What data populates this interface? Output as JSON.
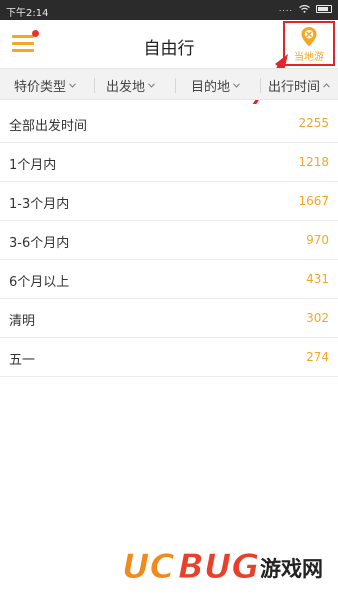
{
  "status_bar": {
    "time": "下午2:14",
    "signal": "....",
    "wifi_icon": "wifi-icon",
    "battery_icon": "battery-icon"
  },
  "header": {
    "title": "自由行",
    "menu_icon": "menu-icon",
    "has_notification": true,
    "local_tour": {
      "label": "当地游",
      "icon": "location-pin-icon"
    }
  },
  "filters": [
    {
      "label": "特价类型"
    },
    {
      "label": "出发地"
    },
    {
      "label": "目的地"
    },
    {
      "label": "出行时间"
    }
  ],
  "list": [
    {
      "name": "全部出发时间",
      "count": "2255"
    },
    {
      "name": "1个月内",
      "count": "1218"
    },
    {
      "name": "1-3个月内",
      "count": "1667"
    },
    {
      "name": "3-6个月内",
      "count": "970"
    },
    {
      "name": "6个月以上",
      "count": "431"
    },
    {
      "name": "清明",
      "count": "302"
    },
    {
      "name": "五一",
      "count": "274"
    }
  ],
  "watermark": {
    "logo": "UCBUG游戏网"
  },
  "colors": {
    "accent": "#f5a623",
    "highlight": "#e0262d",
    "background": "#ffffff",
    "filter_bg": "#f2f2f2"
  }
}
